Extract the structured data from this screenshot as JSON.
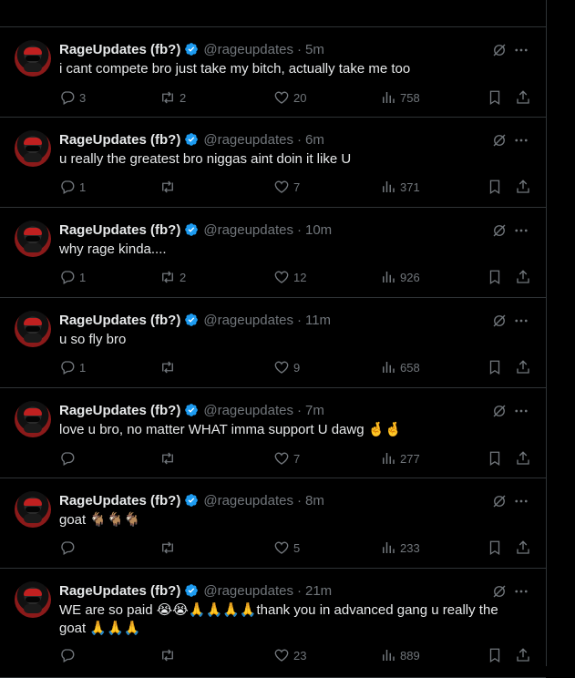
{
  "tweets": [
    {
      "name": "RageUpdates (fb?)",
      "handle": "@rageupdates",
      "dot": "·",
      "time": "5m",
      "text": "i cant compete bro just take my bitch, actually take me too",
      "replies": "3",
      "reposts": "2",
      "likes": "20",
      "views": "758"
    },
    {
      "name": "RageUpdates (fb?)",
      "handle": "@rageupdates",
      "dot": "·",
      "time": "6m",
      "text": "u really the greatest bro niggas aint doin it like U",
      "replies": "1",
      "reposts": "",
      "likes": "7",
      "views": "371"
    },
    {
      "name": "RageUpdates (fb?)",
      "handle": "@rageupdates",
      "dot": "·",
      "time": "10m",
      "text": "why rage kinda....",
      "replies": "1",
      "reposts": "2",
      "likes": "12",
      "views": "926"
    },
    {
      "name": "RageUpdates (fb?)",
      "handle": "@rageupdates",
      "dot": "·",
      "time": "11m",
      "text": "u so fly bro",
      "replies": "1",
      "reposts": "",
      "likes": "9",
      "views": "658"
    },
    {
      "name": "RageUpdates (fb?)",
      "handle": "@rageupdates",
      "dot": "·",
      "time": "7m",
      "text": "love u bro, no matter WHAT imma support U dawg 🤞🤞",
      "replies": "",
      "reposts": "",
      "likes": "7",
      "views": "277"
    },
    {
      "name": "RageUpdates (fb?)",
      "handle": "@rageupdates",
      "dot": "·",
      "time": "8m",
      "text": "goat 🐐🐐🐐",
      "replies": "",
      "reposts": "",
      "likes": "5",
      "views": "233"
    },
    {
      "name": "RageUpdates (fb?)",
      "handle": "@rageupdates",
      "dot": "·",
      "time": "21m",
      "text": "WE are so paid 😭😭🙏🙏🙏🙏thank you in advanced gang u really the goat 🙏🙏🙏",
      "replies": "",
      "reposts": "",
      "likes": "23",
      "views": "889"
    }
  ],
  "colors": {
    "accent": "#1d9bf0",
    "muted": "#71767b",
    "text": "#e7e9ea",
    "border": "#2f3336"
  },
  "icons": [
    "verified-badge-icon",
    "grok-icon",
    "more-icon",
    "reply-icon",
    "repost-icon",
    "like-icon",
    "views-icon",
    "bookmark-icon",
    "share-icon"
  ]
}
